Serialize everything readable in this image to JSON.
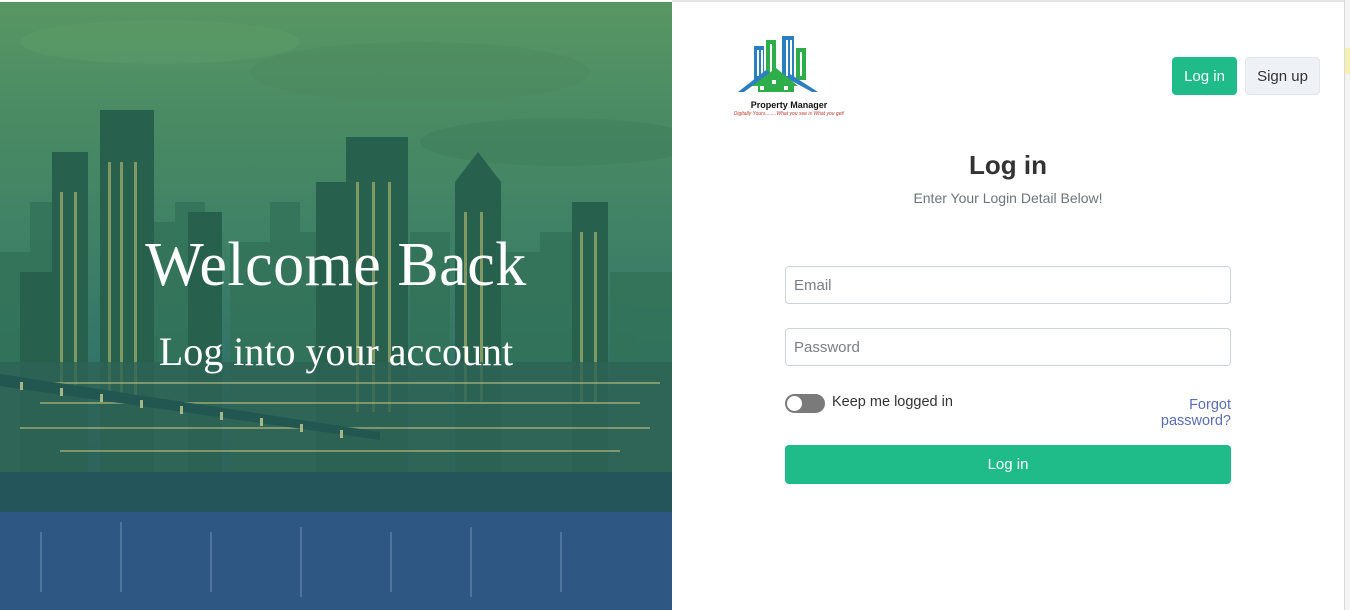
{
  "hero": {
    "title": "Welcome Back",
    "subtitle": "Log into your account"
  },
  "brand": {
    "name": "Property Manager",
    "tagline": "Digitally Yours........What you see is What you get!"
  },
  "header": {
    "login_label": "Log in",
    "signup_label": "Sign up"
  },
  "form": {
    "title": "Log in",
    "subtitle": "Enter Your Login Detail Below!",
    "email_placeholder": "Email",
    "password_placeholder": "Password",
    "remember_label": "Keep me logged in",
    "remember_checked": false,
    "forgot_label": "Forgot password?",
    "submit_label": "Log in"
  },
  "colors": {
    "accent": "#1fbb88",
    "link": "#5a6db4",
    "hero_overlay": "#3f7f67"
  },
  "icons": [
    "building-logo-icon",
    "toggle-switch-icon"
  ]
}
